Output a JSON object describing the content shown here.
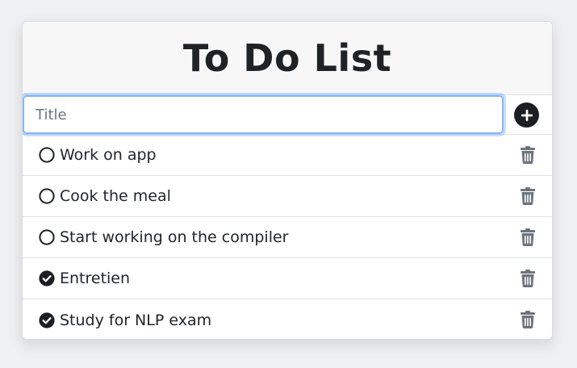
{
  "header": {
    "title": "To Do List"
  },
  "add_form": {
    "input_placeholder": "Title",
    "input_value": "",
    "add_icon": "plus-circle-icon"
  },
  "colors": {
    "accent_focus": "#86b7fe",
    "dark": "#1b1f23",
    "trash": "#6c757d"
  },
  "todos": [
    {
      "text": "Work on app",
      "done": false
    },
    {
      "text": "Cook the meal",
      "done": false
    },
    {
      "text": "Start working on the compiler",
      "done": false
    },
    {
      "text": "Entretien",
      "done": true
    },
    {
      "text": "Study for NLP exam",
      "done": true
    }
  ]
}
